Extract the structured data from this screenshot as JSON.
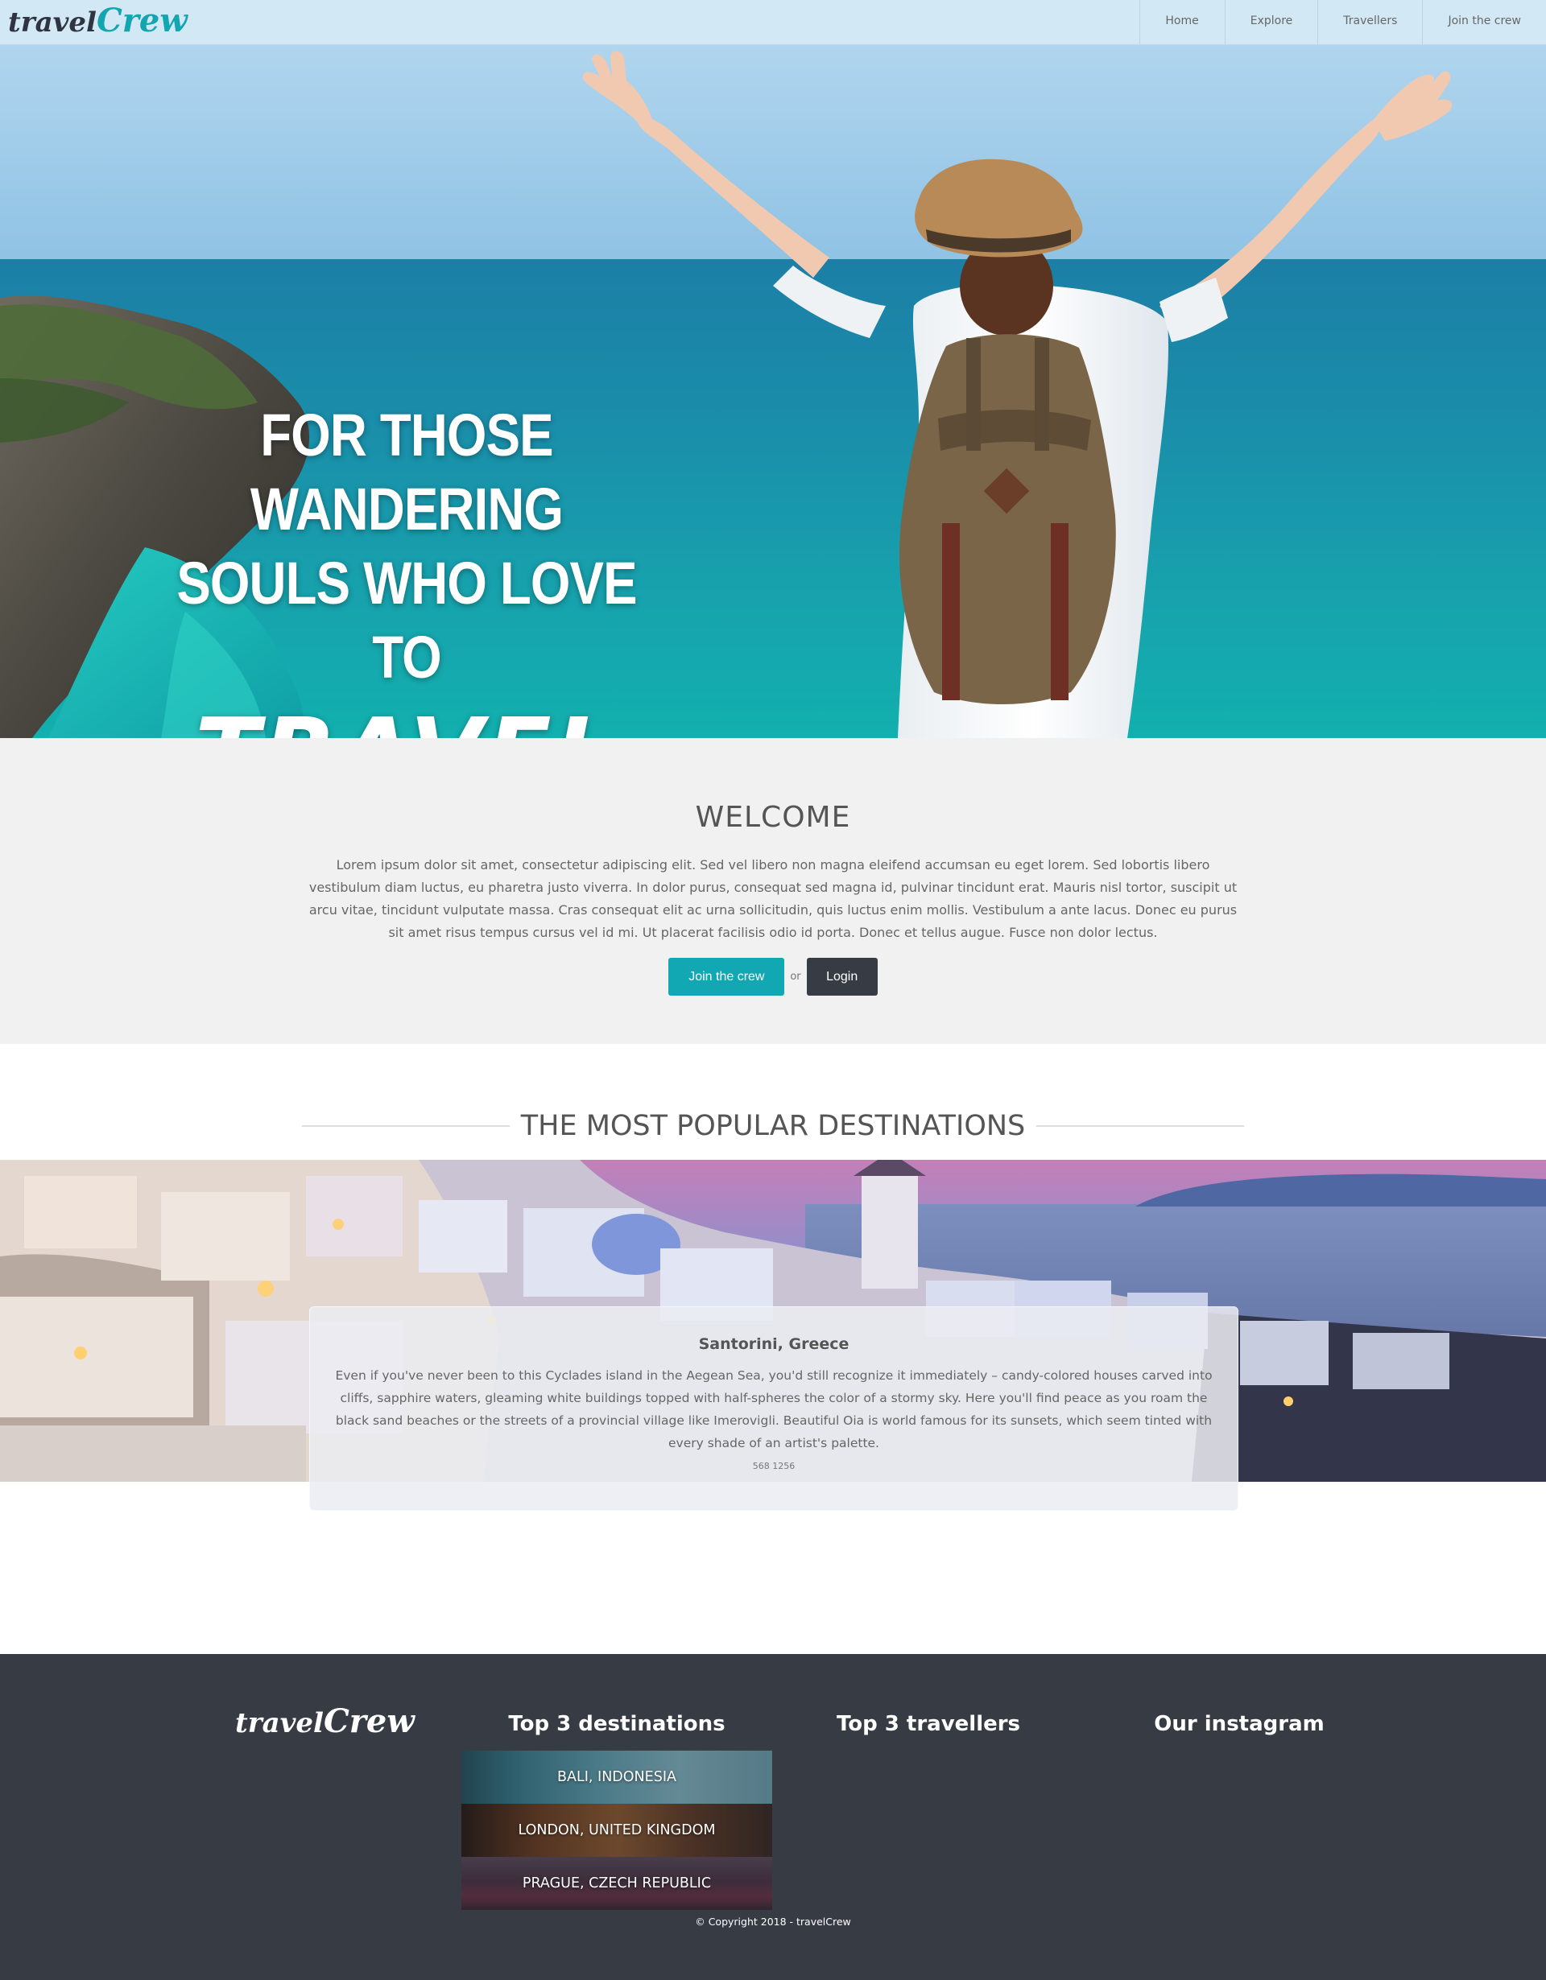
{
  "nav": {
    "logo_part1": "travel",
    "logo_part2": "Crew",
    "links": [
      "Home",
      "Explore",
      "Travellers",
      "Join the crew"
    ]
  },
  "hero": {
    "line1": "FOR THOSE WANDERING",
    "line2": "SOULS WHO LOVE TO",
    "line3": "TRAVEL"
  },
  "welcome": {
    "title": "WELCOME",
    "body": "Lorem ipsum dolor sit amet, consectetur adipiscing elit. Sed vel libero non magna eleifend accumsan eu eget lorem. Sed lobortis libero vestibulum diam luctus, eu pharetra justo viverra. In dolor purus, consequat sed magna id, pulvinar tincidunt erat. Mauris nisl tortor, suscipit ut arcu vitae, tincidunt vulputate massa. Cras consequat elit ac urna sollicitudin, quis luctus enim mollis. Vestibulum a ante lacus. Donec eu purus sit amet risus tempus cursus vel id mi. Ut placerat facilisis odio id porta. Donec et tellus augue. Fusce non dolor lectus.",
    "join_label": "Join the crew",
    "or_label": "or",
    "login_label": "Login"
  },
  "destinations": {
    "heading": "THE MOST POPULAR DESTINATIONS",
    "featured": {
      "name": "Santorini, Greece",
      "description": "Even if you've never been to this Cyclades island in the Aegean Sea, you'd still recognize it immediately – candy-colored houses carved into cliffs, sapphire waters, gleaming white buildings topped with half-spheres the color of a stormy sky. Here you'll find peace as you roam the black sand beaches or the streets of a provincial village like Imerovigli. Beautiful Oia is world famous for its sunsets, which seem tinted with every shade of an artist's palette.",
      "stats": "568 1256"
    }
  },
  "footer": {
    "logo_part1": "travel",
    "logo_part2": "Crew",
    "col_destinations": "Top 3 destinations",
    "col_travellers": "Top 3 travellers",
    "col_instagram": "Our instagram",
    "top_destinations": [
      "BALI, INDONESIA",
      "LONDON, UNITED KINGDOM",
      "PRAGUE, CZECH REPUBLIC"
    ],
    "copyright": "© Copyright 2018 - travelCrew"
  }
}
